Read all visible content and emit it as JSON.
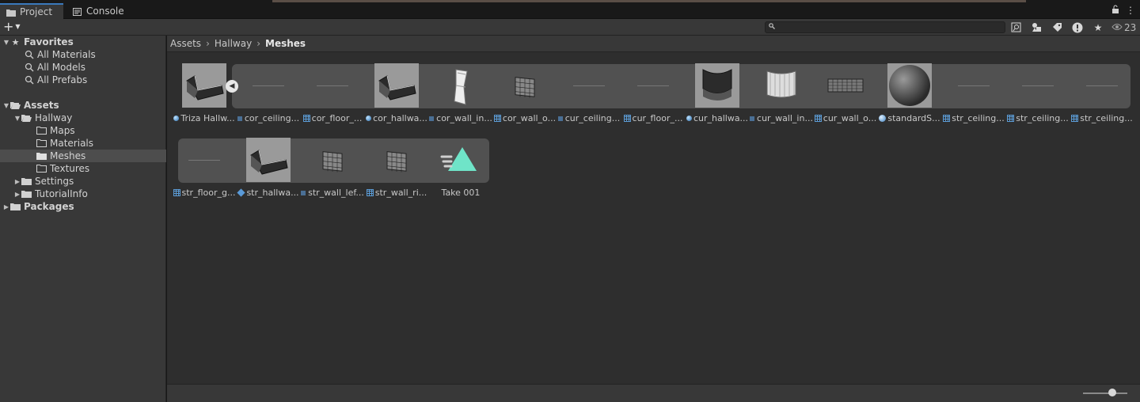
{
  "tabs": [
    {
      "label": "Project",
      "icon": "folder-icon",
      "active": true
    },
    {
      "label": "Console",
      "icon": "console-icon",
      "active": false
    }
  ],
  "toolbar": {
    "add_label": "+",
    "search_placeholder": "",
    "visible_count": "23"
  },
  "sidebar": {
    "favorites": {
      "label": "Favorites",
      "items": [
        "All Materials",
        "All Models",
        "All Prefabs"
      ]
    },
    "assets": {
      "label": "Assets",
      "hallway": "Hallway",
      "hallway_children": [
        "Maps",
        "Materials",
        "Meshes",
        "Textures"
      ],
      "settings": "Settings",
      "tutorialinfo": "TutorialInfo"
    },
    "packages": "Packages",
    "selected": "Meshes"
  },
  "breadcrumb": [
    "Assets",
    "Hallway",
    "Meshes"
  ],
  "assets_row1": [
    {
      "label": "Triza Hallw...",
      "type": "model",
      "thumb": "hallway-mesh"
    },
    {
      "label": "cor_ceiling...",
      "type": "mesh-sm",
      "thumb": "line"
    },
    {
      "label": "cor_floor_...",
      "type": "mesh",
      "thumb": "line"
    },
    {
      "label": "cor_hallwa...",
      "type": "model",
      "thumb": "hallway-mesh"
    },
    {
      "label": "cor_wall_in...",
      "type": "mesh-sm",
      "thumb": "wall"
    },
    {
      "label": "cor_wall_o...",
      "type": "mesh",
      "thumb": "wireframe"
    },
    {
      "label": "cur_ceiling...",
      "type": "mesh-sm",
      "thumb": "line"
    },
    {
      "label": "cur_floor_...",
      "type": "mesh",
      "thumb": "line"
    },
    {
      "label": "cur_hallwa...",
      "type": "model",
      "thumb": "curved-hallway"
    },
    {
      "label": "cur_wall_in...",
      "type": "mesh-sm",
      "thumb": "curved-wall"
    },
    {
      "label": "cur_wall_o...",
      "type": "mesh",
      "thumb": "wireframe-wide"
    },
    {
      "label": "standardS...",
      "type": "mat",
      "thumb": "sphere"
    },
    {
      "label": "str_ceiling...",
      "type": "mesh",
      "thumb": "line"
    },
    {
      "label": "str_ceiling...",
      "type": "mesh",
      "thumb": "line"
    },
    {
      "label": "str_ceiling...",
      "type": "mesh",
      "thumb": "line"
    }
  ],
  "assets_row2": [
    {
      "label": "str_floor_g...",
      "type": "mesh",
      "thumb": "line"
    },
    {
      "label": "str_hallwa...",
      "type": "prefab",
      "thumb": "hallway-mesh"
    },
    {
      "label": "str_wall_lef...",
      "type": "mesh-sm",
      "thumb": "wireframe"
    },
    {
      "label": "str_wall_ri...",
      "type": "mesh",
      "thumb": "wireframe"
    },
    {
      "label": "Take 001",
      "type": "none",
      "thumb": "animation-clip"
    }
  ],
  "colors": {
    "accent": "#3a79bb",
    "anim_clip": "#6fe4c8"
  }
}
